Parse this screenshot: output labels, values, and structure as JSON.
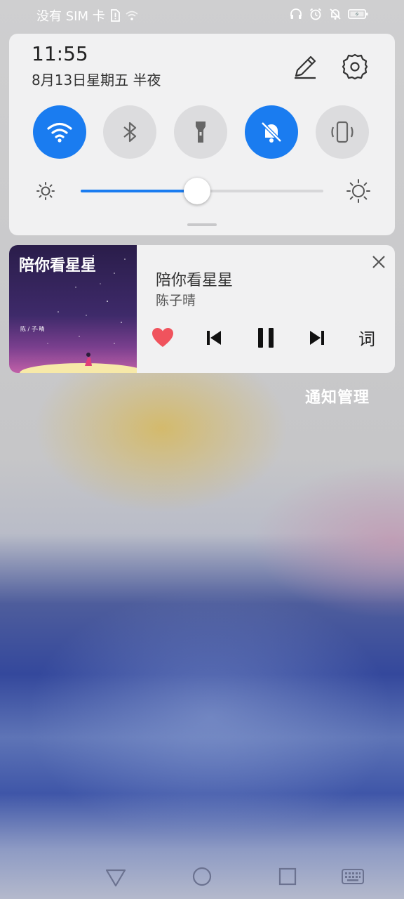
{
  "status_bar": {
    "carrier": "没有 SIM 卡",
    "left_icons": [
      "sim-alert-icon",
      "wifi-icon"
    ],
    "right_icons": [
      "headphone-icon",
      "alarm-icon",
      "bell-off-icon",
      "battery-charging-icon"
    ]
  },
  "quick_settings": {
    "time": "11:55",
    "date": "8月13日星期五 半夜",
    "toggles": [
      {
        "name": "wifi",
        "icon": "wifi-icon",
        "state": "on"
      },
      {
        "name": "bluetooth",
        "icon": "bluetooth-icon",
        "state": "off"
      },
      {
        "name": "flashlight",
        "icon": "flashlight-icon",
        "state": "off"
      },
      {
        "name": "mute",
        "icon": "bell-off-icon",
        "state": "on"
      },
      {
        "name": "vibrate",
        "icon": "vibrate-icon",
        "state": "off"
      }
    ],
    "brightness": 0.48,
    "accent_color": "#1a7cf0"
  },
  "media": {
    "title": "陪你看星星",
    "artist": "陈子晴",
    "album_art_text": "陪你看星星",
    "album_art_small_text": "陈 / 子 晴",
    "lyrics_label": "词",
    "favorite": true,
    "playing": true,
    "heart_color": "#f0535d"
  },
  "notification_manage": "通知管理",
  "nav_bar": [
    "back-icon",
    "home-icon",
    "recents-icon",
    "keyboard-icon"
  ]
}
